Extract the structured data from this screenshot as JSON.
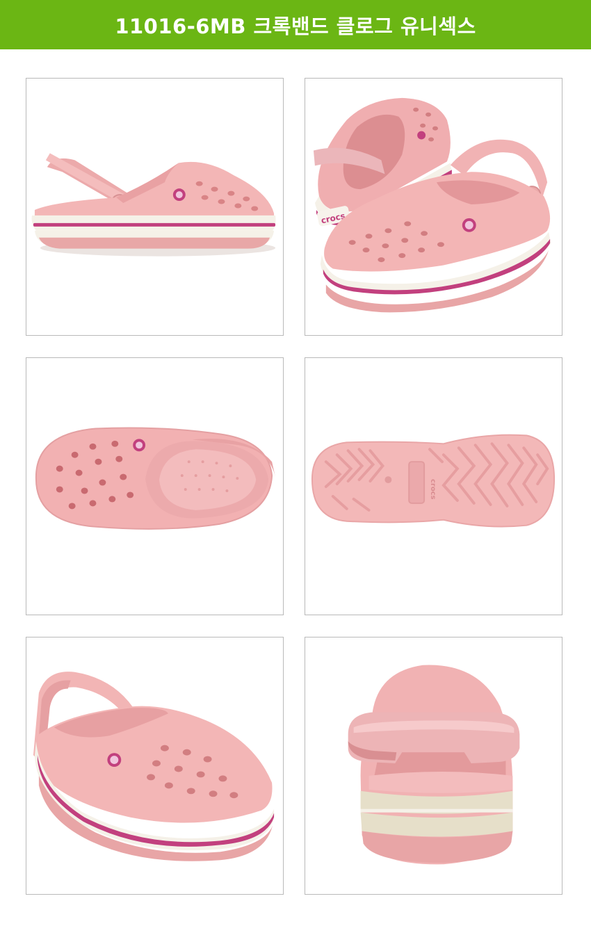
{
  "header": {
    "title": "11016-6MB 크록밴드 클로그 유니섹스",
    "background": "#6bb614",
    "text_color": "#ffffff"
  },
  "gallery": {
    "images": [
      {
        "view": "side"
      },
      {
        "view": "front-angled-pair",
        "badge_text": "crocs"
      },
      {
        "view": "top"
      },
      {
        "view": "sole",
        "sole_text": "crocs"
      },
      {
        "view": "three-quarter"
      },
      {
        "view": "back"
      }
    ],
    "colors": {
      "shoe_pink": "#f2b3b4",
      "shoe_pink_dark": "#e39b9d",
      "stripe_white": "#f4f1ea",
      "stripe_magenta": "#c2407e",
      "tile_border": "#b9b9b9"
    }
  }
}
